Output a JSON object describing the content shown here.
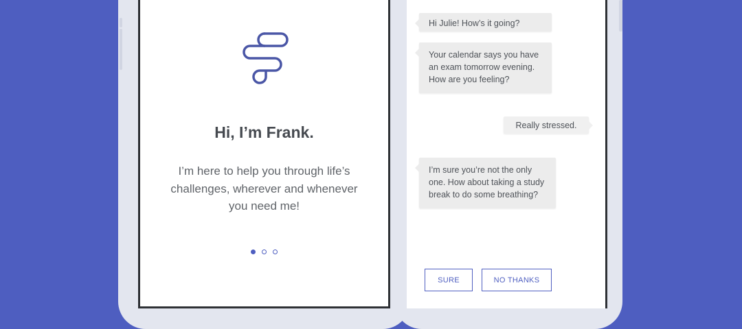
{
  "onboarding": {
    "logo_icon": "frank-logo-icon",
    "headline": "Hi, I’m Frank.",
    "intro_text": "I’m here to help you through life’s challenges, wherever and whenever you need me!",
    "page_dots": {
      "count": 3,
      "active_index": 0
    }
  },
  "chat": {
    "messages": [
      {
        "from": "bot",
        "text": "Hi Julie! How’s it going?"
      },
      {
        "from": "bot",
        "text": "Your calendar says you have an exam tomorrow evening. How are you feeling?"
      },
      {
        "from": "user",
        "text": "Really stressed."
      },
      {
        "from": "bot",
        "text": "I’m sure you’re not the only one. How about taking a study break to do some breathing?"
      }
    ],
    "quick_replies": [
      {
        "label": "SURE"
      },
      {
        "label": "NO THANKS"
      }
    ]
  },
  "colors": {
    "background": "#4e5ec0",
    "accent": "#4e5ec0",
    "bubble": "#ececec",
    "heading_text": "#464a50"
  }
}
